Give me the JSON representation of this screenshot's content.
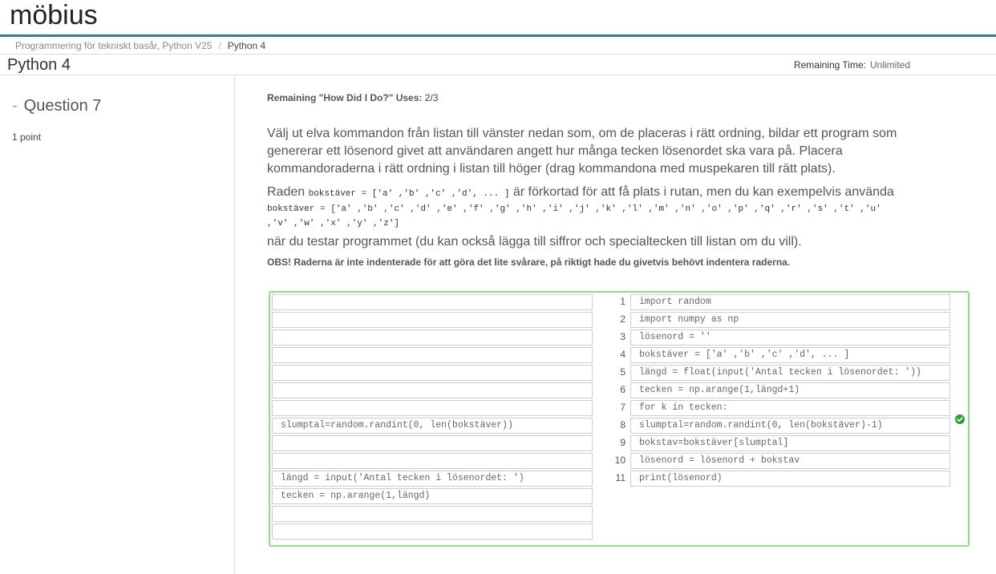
{
  "brand": {
    "logo_text": "möbius"
  },
  "breadcrumb": {
    "course": "Programmering för tekniskt basår, Python V25",
    "separator": "/",
    "current": "Python 4"
  },
  "titlebar": {
    "title": "Python 4",
    "remaining_label": "Remaining Time:",
    "remaining_value": "Unlimited"
  },
  "sidebar": {
    "question_dash": "-",
    "question_title": "Question 7",
    "points": "1 point"
  },
  "main": {
    "hdid_label": "Remaining \"How Did I Do?\" Uses:",
    "hdid_value": "2/3",
    "instructions": "Välj ut elva kommandon från listan till vänster nedan som, om de placeras i rätt ordning, bildar ett program som genererar ett lösenord givet att användaren angett hur många tecken lösenordet ska vara på. Placera kommandoraderna i rätt ordning i listan till höger (drag kommandona med muspekaren till rätt plats).",
    "raden_prefix": "Raden ",
    "raden_code": "bokstäver = ['a' ,'b' ,'c' ,'d', ... ]",
    "raden_suffix": " är förkortad för att få plats i rutan, men du kan exempelvis använda",
    "full_code_line1": "bokstäver = ['a' ,'b' ,'c' ,'d' ,'e' ,'f' ,'g' ,'h' ,'i' ,'j' ,'k' ,'l' ,'m' ,'n' ,'o' ,'p' ,'q' ,'r' ,'s' ,'t' ,'u'",
    "full_code_line2": ",'v' ,'w' ,'x' ,'y' ,'z']",
    "test_note": "när du testar programmet (du kan också lägga till siffror och specialtecken till listan om du vill).",
    "obs": "OBS! Raderna är inte indenterade för att göra det lite svårare, på riktigt hade du givetvis behövt indentera raderna."
  },
  "parsons": {
    "left_slots": [
      "",
      "",
      "",
      "",
      "",
      "",
      "",
      "slumptal=random.randint(0, len(bokstäver))",
      "",
      "",
      "längd = input('Antal tecken i lösenordet: ')",
      "tecken = np.arange(1,längd)",
      "",
      ""
    ],
    "right_lines": [
      {
        "num": "1",
        "code": "import random"
      },
      {
        "num": "2",
        "code": "import numpy as np"
      },
      {
        "num": "3",
        "code": "lösenord = ''"
      },
      {
        "num": "4",
        "code": "bokstäver = ['a' ,'b' ,'c' ,'d', ... ]"
      },
      {
        "num": "5",
        "code": "längd = float(input('Antal tecken i lösenordet: '))"
      },
      {
        "num": "6",
        "code": "tecken = np.arange(1,längd+1)"
      },
      {
        "num": "7",
        "code": "for k in tecken:"
      },
      {
        "num": "8",
        "code": "slumptal=random.randint(0, len(bokstäver)-1)"
      },
      {
        "num": "9",
        "code": "bokstav=bokstäver[slumptal]"
      },
      {
        "num": "10",
        "code": "lösenord = lösenord + bokstav"
      },
      {
        "num": "11",
        "code": "print(lösenord)"
      }
    ],
    "status_icon": "check-circle-icon",
    "status_color": "#2e9e2e",
    "border_color": "#8be08b"
  }
}
